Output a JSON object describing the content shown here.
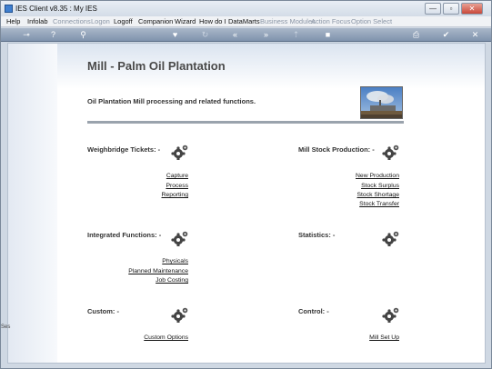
{
  "window": {
    "title": "IES Client v8.35 : My IES"
  },
  "window_buttons": {
    "minimize": "—",
    "maximize": "▫",
    "close": "✕"
  },
  "menu": {
    "items": [
      {
        "label": "Help",
        "enabled": true
      },
      {
        "label": "Infolab",
        "enabled": true
      },
      {
        "label": "Connections",
        "enabled": false
      },
      {
        "label": "Logon",
        "enabled": false
      },
      {
        "label": "Logoff",
        "enabled": true
      },
      {
        "label": "Companion",
        "enabled": true
      },
      {
        "label": "Wizard",
        "enabled": true
      },
      {
        "label": "How do I",
        "enabled": true
      },
      {
        "label": "DataMarts",
        "enabled": true
      },
      {
        "label": "Business Modules",
        "enabled": false
      },
      {
        "label": "Action Focus",
        "enabled": false
      },
      {
        "label": "Option Select",
        "enabled": false
      }
    ]
  },
  "toolbar": {
    "icons": [
      "key-icon",
      "help-icon",
      "search-icon",
      "heart-icon",
      "refresh-icon",
      "rewind-icon",
      "fast-forward-icon",
      "upload-icon",
      "stop-icon",
      "print-icon",
      "check-icon",
      "close-icon"
    ],
    "glyphs": [
      "⊸",
      "?",
      "⚲",
      "♥",
      "↻",
      "«",
      "»",
      "⇡",
      "■",
      "⎙",
      "✔",
      "✕"
    ]
  },
  "page": {
    "title": "Mill - Palm Oil Plantation",
    "description": "Oil Plantation Mill processing and related functions."
  },
  "sections": {
    "weighbridge": {
      "title": "Weighbridge Tickets: -",
      "links": [
        "Capture",
        "Process",
        "Reporting"
      ]
    },
    "mill_stock": {
      "title": "Mill Stock Production: -",
      "links": [
        "New Production",
        "Stock Surplus",
        "Stock Shortage",
        "Stock Transfer"
      ]
    },
    "integrated": {
      "title": "Integrated Functions: -",
      "links": [
        "Physicals",
        "Planned Maintenance",
        "Job Costing"
      ]
    },
    "statistics": {
      "title": "Statistics: -",
      "links": []
    },
    "custom": {
      "title": "Custom: -",
      "links": [
        "Custom Options"
      ]
    },
    "control": {
      "title": "Control: -",
      "links": [
        "Mill Set Up"
      ]
    }
  },
  "side_tab": {
    "label": "Ses"
  },
  "colors": {
    "toolbar": "#7f93ad",
    "divider": "#9aa3ad",
    "gear": "#444444"
  }
}
